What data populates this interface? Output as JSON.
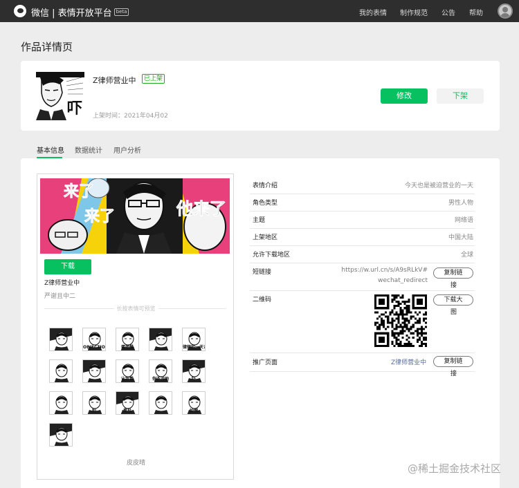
{
  "topbar": {
    "brand": "微信 | 表情开放平台",
    "beta": "beta",
    "nav": [
      "我的表情",
      "制作规范",
      "公告",
      "帮助"
    ]
  },
  "page_title": "作品详情页",
  "work": {
    "name": "Z律师营业中",
    "status": "已上架",
    "on_time": "上架时间：2021年04月02",
    "cover_text": "吓",
    "edit_label": "修改",
    "offline_label": "下架"
  },
  "tabs": [
    "基本信息",
    "数据统计",
    "用户分析"
  ],
  "preview": {
    "banner_texts": [
      "来了",
      "来了",
      "他来了"
    ],
    "download_label": "下载",
    "name": "Z律师营业中",
    "author": "严谢且中二",
    "hint": "长按表情可预览",
    "footer": "皮皮晴",
    "sticker_texts": [
      "",
      "OBJECTION",
      "蛋蛋酷",
      "",
      "律师的一天?",
      "",
      "",
      "让我看",
      "你不对劲",
      "吓",
      "",
      "别",
      "鬼扯",
      "",
      "妙啊",
      ""
    ]
  },
  "info": {
    "rows": [
      {
        "key": "表情介绍",
        "value": "今天也是被迫营业的一天"
      },
      {
        "key": "角色类型",
        "value": "男性人物"
      },
      {
        "key": "主题",
        "value": "网络语"
      },
      {
        "key": "上架地区",
        "value": "中国大陆"
      },
      {
        "key": "允许下载地区",
        "value": "全球"
      }
    ],
    "short_link": {
      "key": "短链接",
      "value_line1": "https://w.url.cn/s/A9sRLkV#",
      "value_line2": "wechat_redirect",
      "btn": "复制链",
      "btn_tail": "接"
    },
    "qr": {
      "key": "二维码",
      "btn": "下载大",
      "btn_tail": "图"
    },
    "promo": {
      "key": "推广页面",
      "link": "Z律师营业中",
      "btn": "复制链",
      "btn_tail": "接"
    }
  },
  "watermark": "@稀土掘金技术社区"
}
